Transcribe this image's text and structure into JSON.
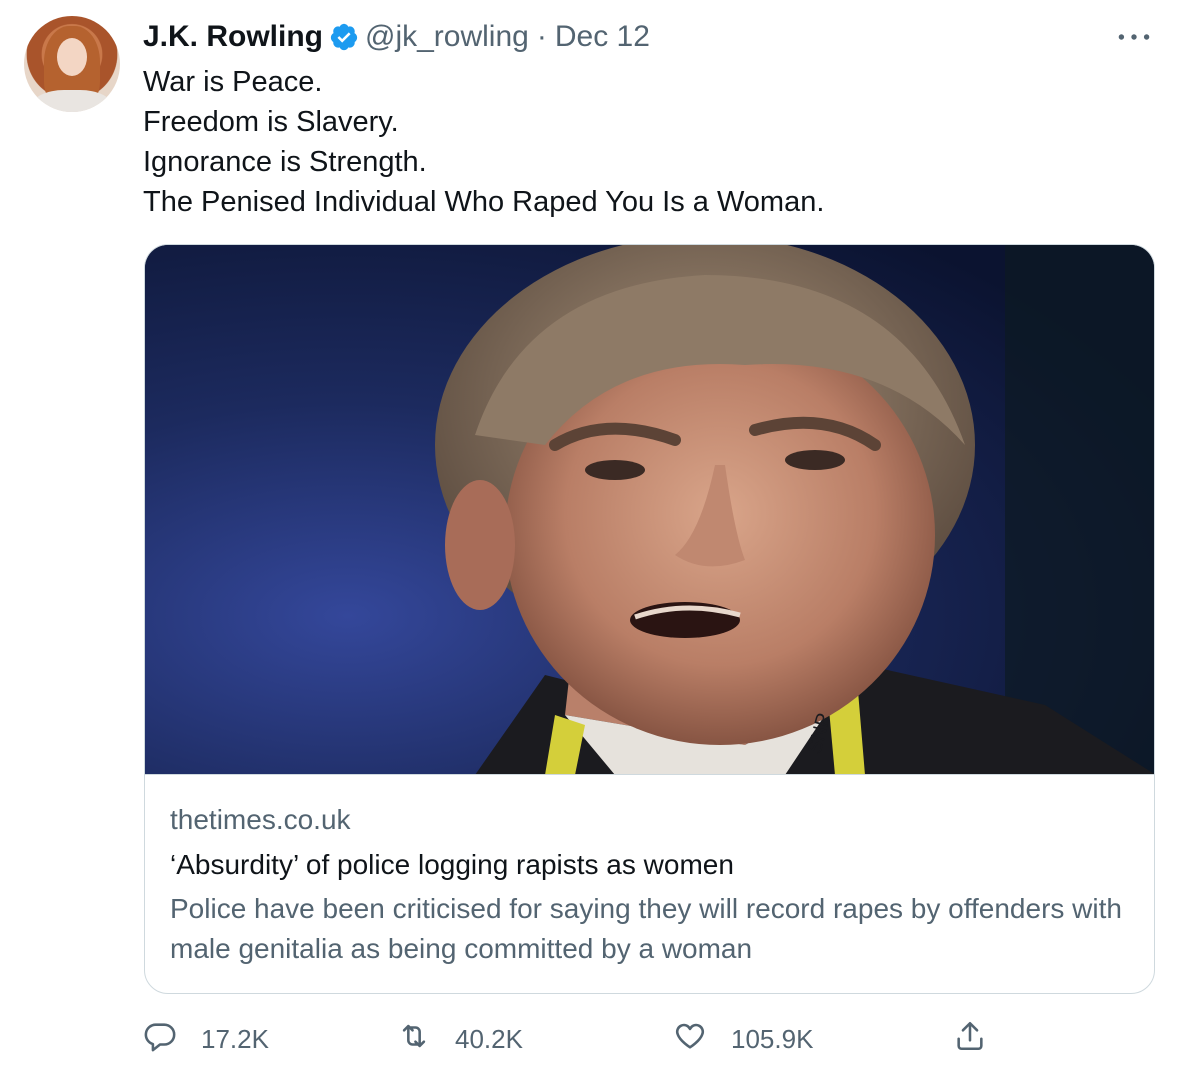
{
  "author": {
    "name": "J.K. Rowling",
    "handle": "@jk_rowling",
    "separator": "·",
    "date": "Dec 12"
  },
  "icons": {
    "verified": "verified-badge-icon",
    "more": "more-icon",
    "reply": "reply-icon",
    "retweet": "retweet-icon",
    "like": "like-icon",
    "share": "share-icon"
  },
  "tweet": {
    "lines": [
      "War is Peace.",
      "Freedom is Slavery.",
      "Ignorance is Strength.",
      "The Penised Individual Who Raped You Is a Woman."
    ]
  },
  "card": {
    "domain": "thetimes.co.uk",
    "title": "‘Absurdity’ of police logging rapists as women",
    "description": "Police have been criticised for saying they will record rapes by offenders with male genitalia as being committed by a woman"
  },
  "stats": {
    "replies": "17.2K",
    "retweets": "40.2K",
    "likes": "105.9K"
  },
  "colors": {
    "verified": "#1d9bf0",
    "secondary_text": "#536471",
    "primary_text": "#0f1419",
    "border": "#cfd9de"
  }
}
